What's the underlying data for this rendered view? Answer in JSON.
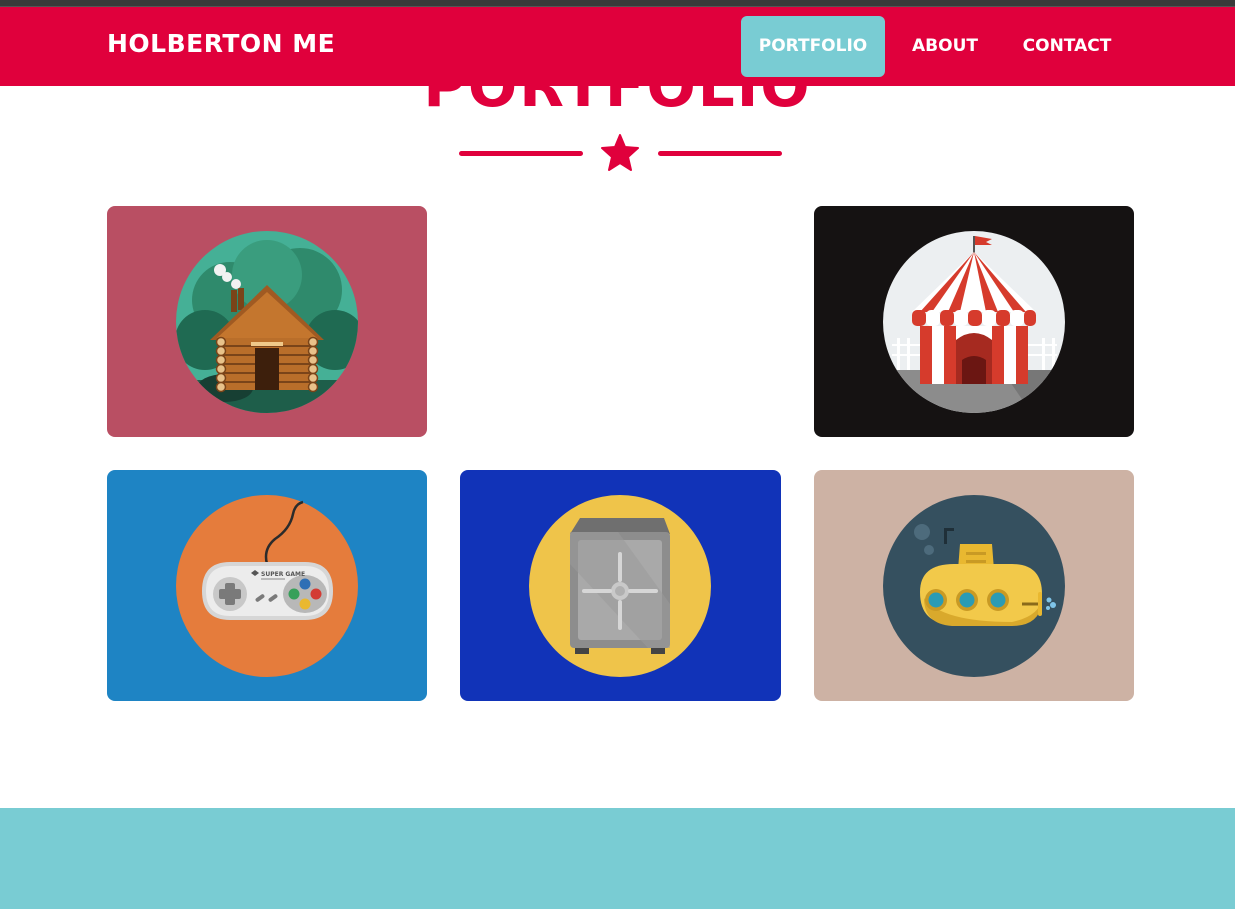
{
  "brand": {
    "title": "HOLBERTON ME"
  },
  "nav": {
    "items": [
      {
        "label": "PORTFOLIO",
        "active": true
      },
      {
        "label": "ABOUT",
        "active": false
      },
      {
        "label": "CONTACT",
        "active": false
      }
    ]
  },
  "section": {
    "title": "PORTFOLIO",
    "divider_icon": "star-icon"
  },
  "portfolio": {
    "items": [
      {
        "icon": "log-cabin-icon",
        "background": "#b94f63"
      },
      {
        "icon": "circus-tent-icon",
        "background": "#151212"
      },
      {
        "icon": "game-controller-icon",
        "background": "#1e84c4",
        "icon_text": "SUPER GAME"
      },
      {
        "icon": "safe-icon",
        "background": "#1133b8"
      },
      {
        "icon": "submarine-icon",
        "background": "#cdb2a4"
      }
    ]
  },
  "colors": {
    "accent": "#e0003c",
    "secondary": "#79ccd3"
  }
}
